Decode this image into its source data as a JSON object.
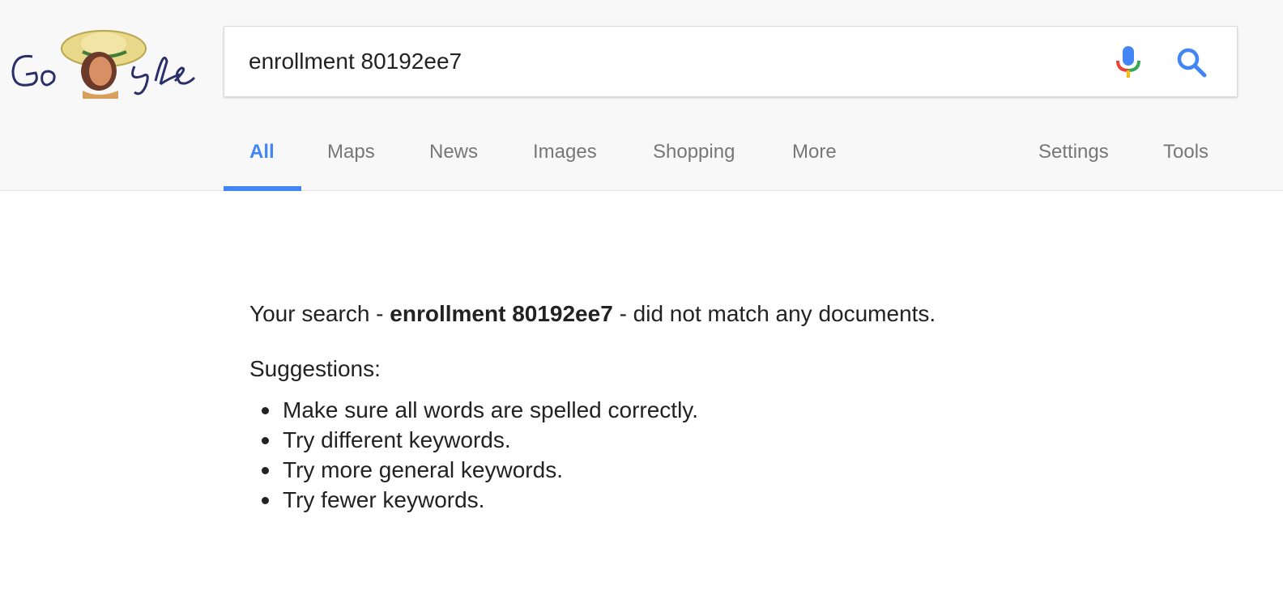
{
  "search": {
    "query": "enrollment 80192ee7"
  },
  "tabs": [
    {
      "label": "All",
      "active": true
    },
    {
      "label": "Maps"
    },
    {
      "label": "News"
    },
    {
      "label": "Images"
    },
    {
      "label": "Shopping"
    },
    {
      "label": "More"
    }
  ],
  "tools": {
    "settings_label": "Settings",
    "tools_label": "Tools"
  },
  "results": {
    "prefix": "Your search -",
    "query_bold": "enrollment 80192ee7",
    "suffix": "- did not match any documents.",
    "suggestions_title": "Suggestions:",
    "suggestions": [
      "Make sure all words are spelled correctly.",
      "Try different keywords.",
      "Try more general keywords.",
      "Try fewer keywords."
    ]
  },
  "icons": {
    "logo": "google-doodle-logo",
    "mic": "microphone-icon",
    "search": "magnifier-icon"
  },
  "colors": {
    "accent": "#4285f4",
    "tab_text": "#777777",
    "text": "#222222",
    "header_bg": "#f8f8f8"
  }
}
